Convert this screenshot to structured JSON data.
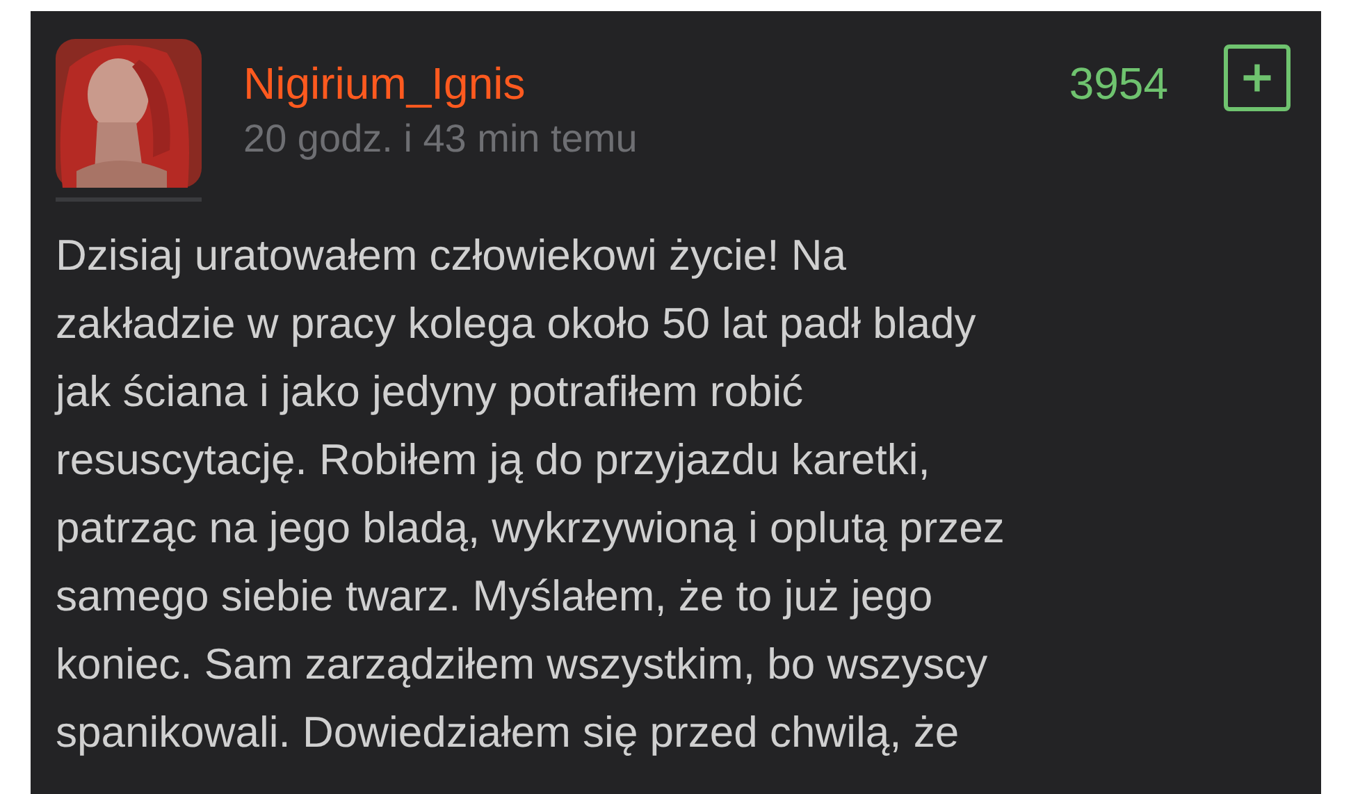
{
  "post": {
    "author": "Nigirium_Ignis",
    "time": "20 godz. i 43 min temu",
    "score": "3954",
    "body_lines": [
      "Dzisiaj uratowałem człowiekowi życie! Na",
      "zakładzie w pracy kolega około 50 lat padł blady",
      "jak ściana i jako jedyny potrafiłem robić",
      "resuscytację. Robiłem ją do przyjazdu karetki,",
      "patrząc na jego bladą, wykrzywioną i oplutą przez",
      "samego siebie twarz. Myślałem, że to już jego",
      "koniec. Sam zarządziłem wszystkim, bo wszyscy",
      "spanikowali. Dowiedziałem się przed chwilą, że"
    ]
  }
}
